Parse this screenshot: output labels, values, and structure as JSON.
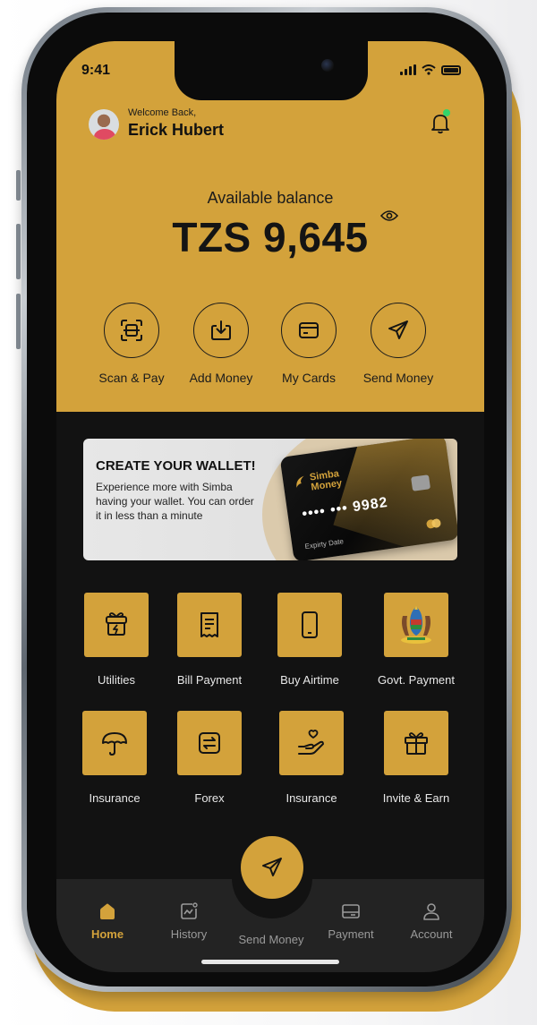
{
  "status_bar": {
    "time": "9:41"
  },
  "header": {
    "welcome": "Welcome Back,",
    "username": "Erick Hubert"
  },
  "balance": {
    "label": "Available balance",
    "amount": "TZS 9,645"
  },
  "quick_actions": [
    {
      "label": "Scan & Pay",
      "icon": "scan-icon"
    },
    {
      "label": "Add Money",
      "icon": "download-icon"
    },
    {
      "label": "My Cards",
      "icon": "card-icon"
    },
    {
      "label": "Send Money",
      "icon": "send-icon"
    }
  ],
  "banner": {
    "title": "CREATE YOUR WALLET!",
    "text": "Experience more with Simba having your wallet. You can order it in less than a minute",
    "card": {
      "brand_line1": "Simba",
      "brand_line2": "Money",
      "number": "•••• ••• 9982",
      "expiry_label": "Expirty Date"
    }
  },
  "services": [
    {
      "label": "Utilities",
      "icon": "utilities-icon"
    },
    {
      "label": "Bill Payment",
      "icon": "receipt-icon"
    },
    {
      "label": "Buy Airtime",
      "icon": "phone-icon"
    },
    {
      "label": "Govt. Payment",
      "icon": "coat-of-arms-icon"
    },
    {
      "label": "Insurance",
      "icon": "umbrella-icon"
    },
    {
      "label": "Forex",
      "icon": "exchange-icon"
    },
    {
      "label": "Insurance",
      "icon": "hand-heart-icon"
    },
    {
      "label": "Invite & Earn",
      "icon": "gift-icon"
    }
  ],
  "bottom_nav": [
    {
      "label": "Home",
      "icon": "home-icon",
      "active": true
    },
    {
      "label": "History",
      "icon": "history-icon",
      "active": false
    },
    {
      "label": "Send Money",
      "icon": "send-icon",
      "active": false
    },
    {
      "label": "Payment",
      "icon": "wallet-icon",
      "active": false
    },
    {
      "label": "Account",
      "icon": "user-icon",
      "active": false
    }
  ],
  "colors": {
    "accent": "#d3a23b",
    "dark_bg": "#121212",
    "nav_bg": "#232323",
    "online_dot": "#33d46a"
  }
}
